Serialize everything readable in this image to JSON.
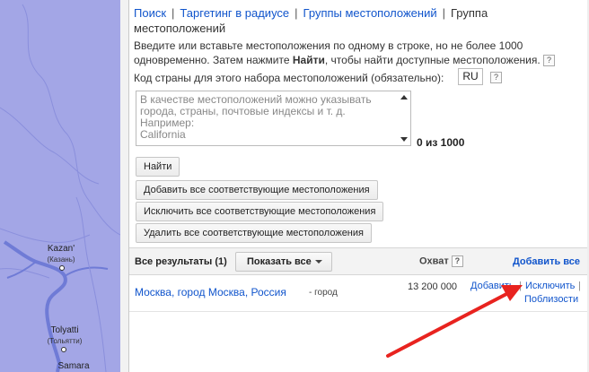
{
  "map": {
    "cities": [
      {
        "name": "Kazan'",
        "local": "(Казань)"
      },
      {
        "name": "Tolyatti",
        "local": "(Тольятти)"
      },
      {
        "name": "Samara",
        "local": ""
      }
    ],
    "water_color": "#6f7bd6",
    "land_color": "#a3a6e6"
  },
  "nav": {
    "search": "Поиск",
    "radius": "Таргетинг в радиусе",
    "groups": "Группы местоположений",
    "current_line1": "Группа",
    "current_line2": "местоположений"
  },
  "instructions": {
    "text_before": "Введите или вставьте местоположения по одному в строке, но не более 1000 одновременно. Затем нажмите ",
    "bold": "Найти",
    "text_after": ", чтобы найти доступные местоположения.",
    "help": "?"
  },
  "country": {
    "label": "Код страны для этого набора местоположений (обязательно):",
    "value": "RU",
    "help": "?"
  },
  "textarea": {
    "line1": "В качестве местоположений можно указывать",
    "line2": "города, страны, почтовые индексы и т. д.",
    "line3": "Например:",
    "line4": "California"
  },
  "counter": "0 из 1000",
  "buttons": {
    "find": "Найти",
    "add_all": "Добавить все соответствующие местоположения",
    "exclude_all": "Исключить все соответствующие местоположения",
    "remove_all": "Удалить все соответствующие местоположения"
  },
  "results": {
    "title": "Все результаты (1)",
    "show_label": "Показать все",
    "reach_label": "Охват",
    "reach_help": "?",
    "add_all_link": "Добавить все",
    "rows": [
      {
        "location": "Москва, город Москва, Россия",
        "type": "- город",
        "reach": "13 200 000",
        "actions": {
          "add": "Добавить",
          "exclude": "Исключить",
          "nearby": "Поблизости"
        }
      }
    ]
  },
  "colors": {
    "link": "#1155cc",
    "arrow": "#e8231f"
  }
}
